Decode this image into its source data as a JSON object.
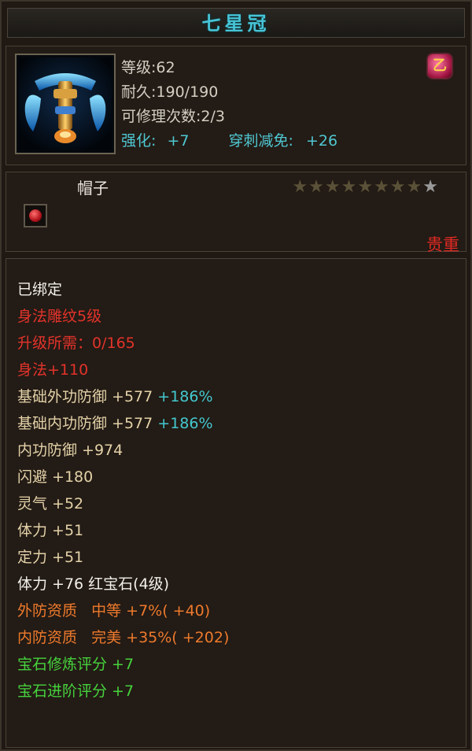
{
  "item": {
    "name": "七星冠",
    "level_line": "等级:62",
    "durability_line": "耐久:190/190",
    "repair_line": "可修理次数:2/3",
    "enhance_label": "强化:",
    "enhance_value": "+7",
    "pierce_label": "穿刺减免:",
    "pierce_value": "+26",
    "class_badge_char": "乙",
    "type": "帽子",
    "stars_total": 9,
    "stars_lit": 1,
    "rarity": "贵重",
    "icon": "crown-helmet-icon"
  },
  "stats": {
    "bound": "已绑定",
    "engraving": "身法雕纹5级",
    "upgrade_need": "升级所需：0/165",
    "agility": "身法+110",
    "base_ext_def": "基础外功防御 +577",
    "base_ext_def_pct": "+186%",
    "base_int_def": "基础内功防御 +577",
    "base_int_def_pct": "+186%",
    "int_def": "内功防御 +974",
    "dodge": "闪避 +180",
    "spirit": "灵气 +52",
    "vitality": "体力 +51",
    "focus": "定力 +51",
    "gem_line": "体力 +76 红宝石(4级)",
    "ext_quality": "外防资质   中等 +7%( +40)",
    "int_quality": "内防资质   完美 +35%( +202)",
    "gem_refine": "宝石修炼评分 +7",
    "gem_advance": "宝石进阶评分 +7"
  },
  "colors": {
    "title": "#46c4d6",
    "red": "#e2332b",
    "orange": "#ee7a2c",
    "green": "#46d33d",
    "cyan": "#43c8cf"
  }
}
